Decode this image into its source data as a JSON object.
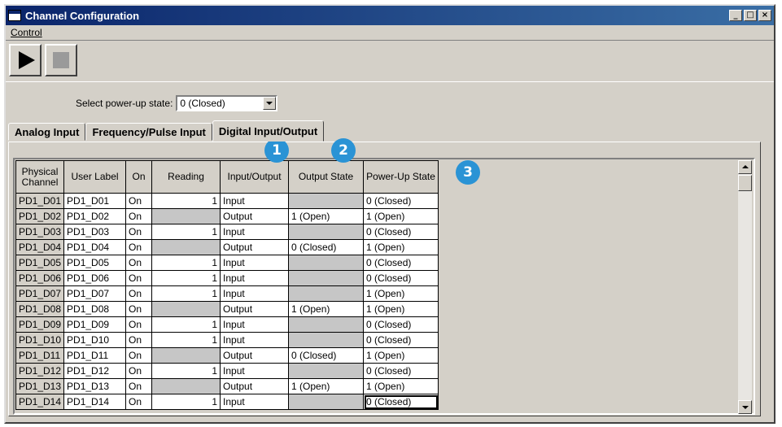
{
  "window": {
    "title": "Channel Configuration",
    "minimize": "_",
    "maximize": "□",
    "close": "×"
  },
  "menu": {
    "control": "Control"
  },
  "powerup": {
    "label": "Select power-up state:",
    "value": "0 (Closed)"
  },
  "tabs": [
    "Analog Input",
    "Frequency/Pulse Input",
    "Digital Input/Output"
  ],
  "callouts": [
    "1",
    "2",
    "3"
  ],
  "columns": {
    "physical": "Physical Channel",
    "user_label": "User Label",
    "on": "On",
    "reading": "Reading",
    "io": "Input/Output",
    "output_state": "Output State",
    "powerup": "Power-Up State"
  },
  "rows": [
    {
      "phys": "PD1_D01",
      "label": "PD1_D01",
      "on": "On",
      "reading": "1",
      "io": "Input",
      "out": "",
      "pu": "0 (Closed)"
    },
    {
      "phys": "PD1_D02",
      "label": "PD1_D02",
      "on": "On",
      "reading": "",
      "io": "Output",
      "out": "1 (Open)",
      "pu": "1 (Open)"
    },
    {
      "phys": "PD1_D03",
      "label": "PD1_D03",
      "on": "On",
      "reading": "1",
      "io": "Input",
      "out": "",
      "pu": "0 (Closed)"
    },
    {
      "phys": "PD1_D04",
      "label": "PD1_D04",
      "on": "On",
      "reading": "",
      "io": "Output",
      "out": "0 (Closed)",
      "pu": "1 (Open)"
    },
    {
      "phys": "PD1_D05",
      "label": "PD1_D05",
      "on": "On",
      "reading": "1",
      "io": "Input",
      "out": "",
      "pu": "0 (Closed)"
    },
    {
      "phys": "PD1_D06",
      "label": "PD1_D06",
      "on": "On",
      "reading": "1",
      "io": "Input",
      "out": "",
      "pu": "0 (Closed)"
    },
    {
      "phys": "PD1_D07",
      "label": "PD1_D07",
      "on": "On",
      "reading": "1",
      "io": "Input",
      "out": "",
      "pu": "1 (Open)"
    },
    {
      "phys": "PD1_D08",
      "label": "PD1_D08",
      "on": "On",
      "reading": "",
      "io": "Output",
      "out": "1 (Open)",
      "pu": "1 (Open)"
    },
    {
      "phys": "PD1_D09",
      "label": "PD1_D09",
      "on": "On",
      "reading": "1",
      "io": "Input",
      "out": "",
      "pu": "0 (Closed)"
    },
    {
      "phys": "PD1_D10",
      "label": "PD1_D10",
      "on": "On",
      "reading": "1",
      "io": "Input",
      "out": "",
      "pu": "0 (Closed)"
    },
    {
      "phys": "PD1_D11",
      "label": "PD1_D11",
      "on": "On",
      "reading": "",
      "io": "Output",
      "out": "0 (Closed)",
      "pu": "1 (Open)"
    },
    {
      "phys": "PD1_D12",
      "label": "PD1_D12",
      "on": "On",
      "reading": "1",
      "io": "Input",
      "out": "",
      "pu": "0 (Closed)"
    },
    {
      "phys": "PD1_D13",
      "label": "PD1_D13",
      "on": "On",
      "reading": "",
      "io": "Output",
      "out": "1 (Open)",
      "pu": "1 (Open)"
    },
    {
      "phys": "PD1_D14",
      "label": "PD1_D14",
      "on": "On",
      "reading": "1",
      "io": "Input",
      "out": "",
      "pu": "0 (Closed)"
    }
  ]
}
